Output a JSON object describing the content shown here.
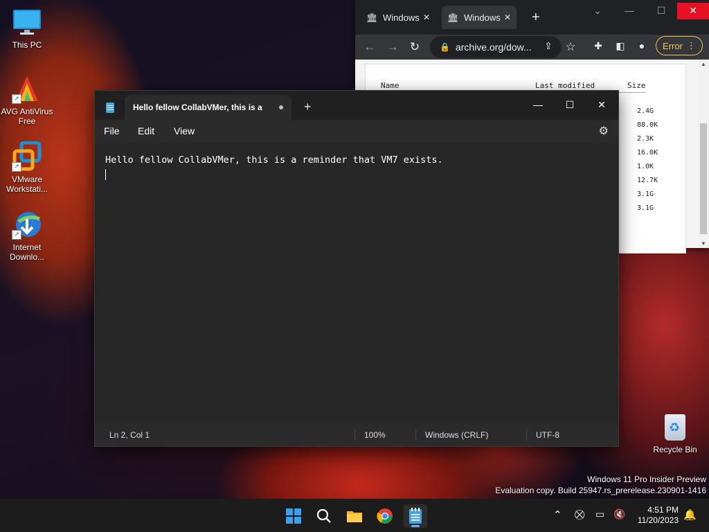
{
  "desktop": {
    "icons": [
      {
        "label": "This PC",
        "icon": "monitor-icon"
      },
      {
        "label": "AVG AntiVirus Free",
        "icon": "avg-icon"
      },
      {
        "label": "VMware Workstati...",
        "icon": "vmware-icon"
      },
      {
        "label": "Internet Downlo...",
        "icon": "idm-icon"
      }
    ],
    "recycle_bin_label": "Recycle Bin",
    "watermark_line1": "Windows 11 Pro Insider Preview",
    "watermark_line2": "Evaluation copy. Build 25947.rs_prerelease.230901-1416"
  },
  "browser": {
    "tabs": [
      {
        "label": "Windows",
        "icon": "archive-icon"
      },
      {
        "label": "Windows",
        "icon": "archive-icon"
      }
    ],
    "address": "archive.org/dow...",
    "error_label": "Error",
    "columns": {
      "name": "Name",
      "modified": "Last modified",
      "size": "Size"
    },
    "sizes": [
      "2.4G",
      "88.0K",
      "2.3K",
      "16.0K",
      "1.0K",
      "12.7K",
      "3.1G",
      "3.1G"
    ]
  },
  "notepad": {
    "tab_title": "Hello fellow CollabVMer, this is a",
    "menu": {
      "file": "File",
      "edit": "Edit",
      "view": "View"
    },
    "content": "Hello fellow CollabVMer, this is a reminder that VM7 exists.",
    "status": {
      "position": "Ln 2, Col 1",
      "zoom": "100%",
      "line_ending": "Windows (CRLF)",
      "encoding": "UTF-8"
    }
  },
  "taskbar": {
    "time": "4:51 PM",
    "date": "11/20/2023",
    "apps": [
      "start-icon",
      "search-icon",
      "file-explorer-icon",
      "chrome-icon",
      "notepad-icon"
    ]
  },
  "colors": {
    "accent": "#66b8ff",
    "error": "#f6c863",
    "close_red": "#e81123"
  }
}
